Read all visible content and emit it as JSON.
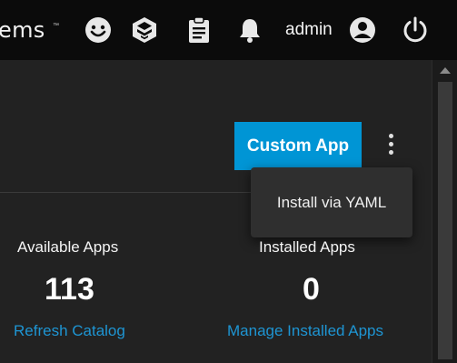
{
  "header": {
    "brand_text": "ems",
    "brand_tm": "™",
    "user_label": "admin",
    "icons": [
      "feedback-smiley-icon",
      "truecommand-icon",
      "jobs-clipboard-icon",
      "alerts-bell-icon",
      "account-circle-icon",
      "power-icon"
    ]
  },
  "toolbar": {
    "custom_app_label": "Custom App",
    "more_actions_icon": "kebab-menu-icon"
  },
  "menu": {
    "items": [
      {
        "label": "Install via YAML"
      }
    ]
  },
  "stats": [
    {
      "label": "Available Apps",
      "value": "113",
      "link": "Refresh Catalog"
    },
    {
      "label": "Installed Apps",
      "value": "0",
      "link": "Manage Installed Apps"
    }
  ],
  "colors": {
    "accent": "#0095d5",
    "link": "#1e95d3",
    "topbar_bg": "#0b0b0b",
    "panel_bg": "#222222",
    "menu_bg": "#2f2f2f"
  }
}
